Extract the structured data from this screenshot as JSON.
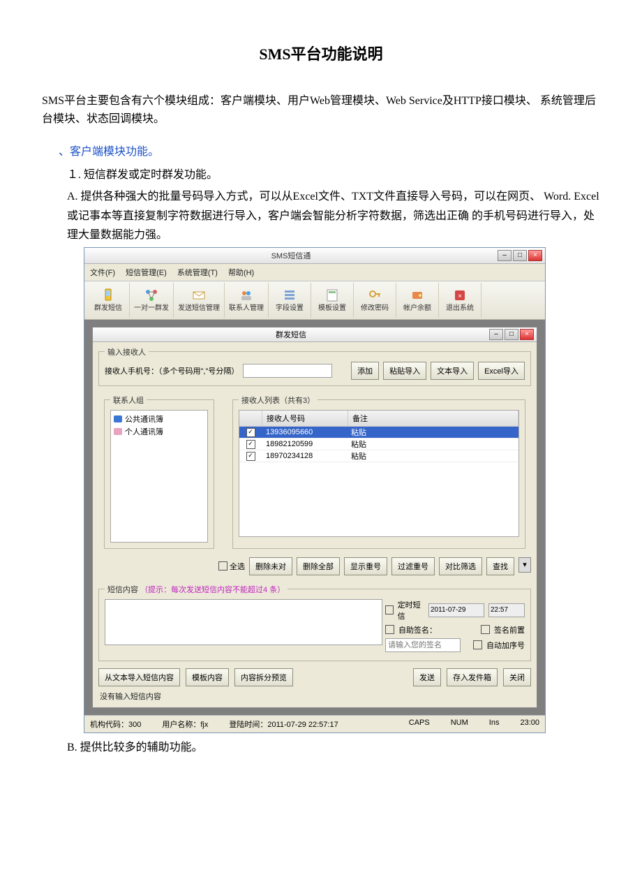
{
  "doc": {
    "title": "SMS平台功能说明",
    "intro": "SMS平台主要包含有六个模块组成：客户端模块、用户Web管理模块、Web Service及HTTP接口模块、   系统管理后台模块、状态回调模块。",
    "section1_head": "、客户端模块功能。",
    "item1": "１. 短信群发或定时群发功能。",
    "itemA": "A. 提供各种强大的批量号码导入方式，可以从Excel文件、TXT文件直接导入号码，可以在网页、  Word.  Excel或记事本等直接复制字符数据进行导入，客户端会智能分析字符数据，筛选出正确 的手机号码进行导入，处理大量数据能力强。",
    "itemB": "B. 提供比较多的辅助功能。"
  },
  "app": {
    "window_title": "SMS短信通",
    "menu": {
      "file": "文件(F)",
      "sms": "短信管理(E)",
      "sys": "系统管理(T)",
      "help": "帮助(H)"
    },
    "toolbar": [
      {
        "id": "group-send",
        "label": "群发短信"
      },
      {
        "id": "one-to-one",
        "label": "一对一群发"
      },
      {
        "id": "send-mgmt",
        "label": "发送短信管理"
      },
      {
        "id": "contacts",
        "label": "联系人管理"
      },
      {
        "id": "field-set",
        "label": "字段设置"
      },
      {
        "id": "tpl-set",
        "label": "模板设置"
      },
      {
        "id": "chg-pwd",
        "label": "修改密码"
      },
      {
        "id": "acct-top",
        "label": "帐户余额"
      },
      {
        "id": "exit",
        "label": "退出系统"
      }
    ],
    "mdi_title": "群发短信",
    "recv_input_legend": "输入接收人",
    "recv_label": "接收人手机号：（多个号码用\",\"号分隔）",
    "btn_add": "添加",
    "btn_paste_import": "粘贴导入",
    "btn_txt_import": "文本导入",
    "btn_excel_import": "Excel导入",
    "contact_group_legend": "联系人组",
    "contact_groups": [
      {
        "name": "公共通讯簿",
        "style": "blue"
      },
      {
        "name": "个人通讯簿",
        "style": "pink"
      }
    ],
    "recv_list_legend": "接收人列表（共有3）",
    "recv_cols": {
      "c1": "接收人号码",
      "c2": "备注"
    },
    "recv_rows": [
      {
        "num": "13936095660",
        "note": "粘贴",
        "selected": true
      },
      {
        "num": "18982120599",
        "note": "粘贴",
        "selected": false
      },
      {
        "num": "18970234128",
        "note": "粘贴",
        "selected": false
      }
    ],
    "ops": {
      "select_all": "全选",
      "del_unsel": "删除未对",
      "del_all": "删除全部",
      "show_dup": "显示重号",
      "filter_dup": "过滤重号",
      "compare": "对比筛选",
      "query": "查找"
    },
    "msg_legend": "短信内容",
    "msg_hint": "（提示：每次发送短信内容不能超过4 条）",
    "sched": {
      "timed": "定时短信",
      "date": "2011-07-29",
      "time": "22:57",
      "autosig": "自助签名：",
      "sigfront": "签名前置",
      "sig_placeholder": "请输入您的签名",
      "autoseq": "自动加序号"
    },
    "bottom": {
      "import_txt": "从文本导入短信内容",
      "tpl_content": "模板内容",
      "preview": "内容拆分预览",
      "send": "发送",
      "save_outbox": "存入发件箱",
      "close": "关闭",
      "no_content": "没有输入短信内容"
    },
    "status": {
      "org": "机构代码：300",
      "user": "用户名称：fjx",
      "login": "登陆时间：2011-07-29 22:57:17",
      "caps": "CAPS",
      "num": "NUM",
      "ins": "Ins",
      "clock": "23:00"
    }
  }
}
